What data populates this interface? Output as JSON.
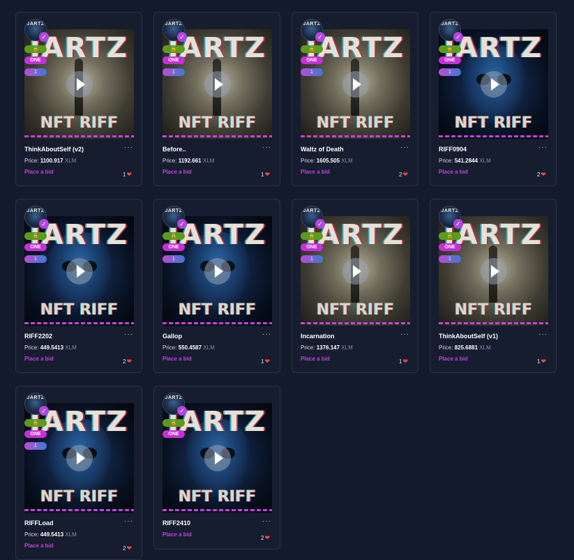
{
  "common": {
    "price_label": "Price:",
    "currency": "XLM",
    "bid_label": "Place a bid",
    "pill_one": "ONE",
    "lock_glyph": "🔒",
    "menu_glyph": "···",
    "heart_glyph": "❤",
    "verified_glyph": "✓",
    "avatar_text": "JARTZ",
    "art_title": "JARTZ",
    "art_subtitle": "NFT RIFF"
  },
  "colors": {
    "accent": "#c640e0",
    "lock_pill": "#5c9b1d",
    "heart": "#f0424e",
    "background": "#131a2b"
  },
  "cards": [
    {
      "title": "ThinkAboutSelf (v2)",
      "price": "1100.917",
      "likes": "1",
      "edition": "1",
      "art": "graveyard"
    },
    {
      "title": "Before..",
      "price": "1192.661",
      "likes": "1",
      "edition": "1",
      "art": "graveyard"
    },
    {
      "title": "Waltz of Death",
      "price": "1605.505",
      "likes": "2",
      "edition": "1",
      "art": "graveyard"
    },
    {
      "title": "RIFF0904",
      "price": "541.2844",
      "likes": "2",
      "edition": "1",
      "art": "skull"
    },
    {
      "title": "RIFF2202",
      "price": "449.5413",
      "likes": "2",
      "edition": "1",
      "art": "skull"
    },
    {
      "title": "Gallop",
      "price": "550.4587",
      "likes": "1",
      "edition": "1",
      "art": "skull"
    },
    {
      "title": "Incarnation",
      "price": "1376.147",
      "likes": "1",
      "edition": "1",
      "art": "graveyard"
    },
    {
      "title": "ThinkAboutSelf (v1)",
      "price": "825.6881",
      "likes": "1",
      "edition": "1",
      "art": "graveyard"
    },
    {
      "title": "RIFFLoad",
      "price": "449.5413",
      "likes": "2",
      "edition": "1",
      "art": "skull"
    },
    {
      "title": "RIFF2410",
      "price": null,
      "likes": "2",
      "edition": null,
      "art": "skull"
    }
  ]
}
